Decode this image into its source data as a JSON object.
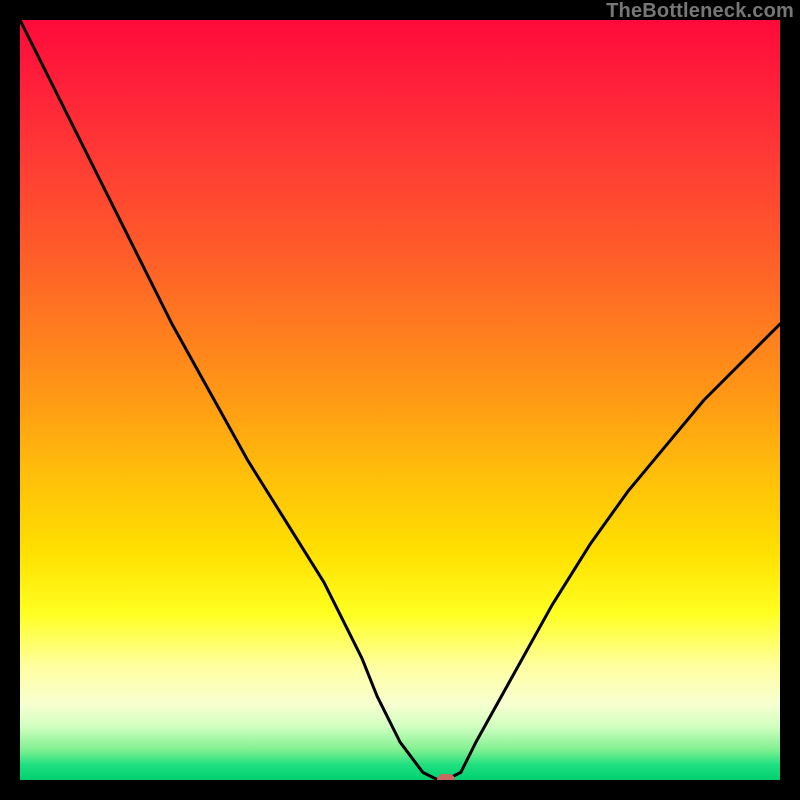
{
  "watermark": "TheBottleneck.com",
  "colors": {
    "curve_stroke": "#000000",
    "marker_fill": "#c76a60",
    "frame_bg": "#000000"
  },
  "chart_data": {
    "type": "line",
    "title": "",
    "xlabel": "",
    "ylabel": "",
    "xlim": [
      0,
      100
    ],
    "ylim": [
      0,
      100
    ],
    "grid": false,
    "legend": false,
    "series": [
      {
        "name": "bottleneck-curve",
        "x": [
          0,
          5,
          10,
          15,
          20,
          25,
          30,
          35,
          40,
          45,
          47,
          50,
          53,
          55,
          56,
          58,
          60,
          65,
          70,
          75,
          80,
          85,
          90,
          95,
          100
        ],
        "values": [
          100,
          90,
          80,
          70,
          60,
          51,
          42,
          34,
          26,
          16,
          11,
          5,
          1,
          0,
          0,
          1,
          5,
          14,
          23,
          31,
          38,
          44,
          50,
          55,
          60
        ]
      }
    ],
    "marker": {
      "x": 56,
      "y": 0
    }
  }
}
